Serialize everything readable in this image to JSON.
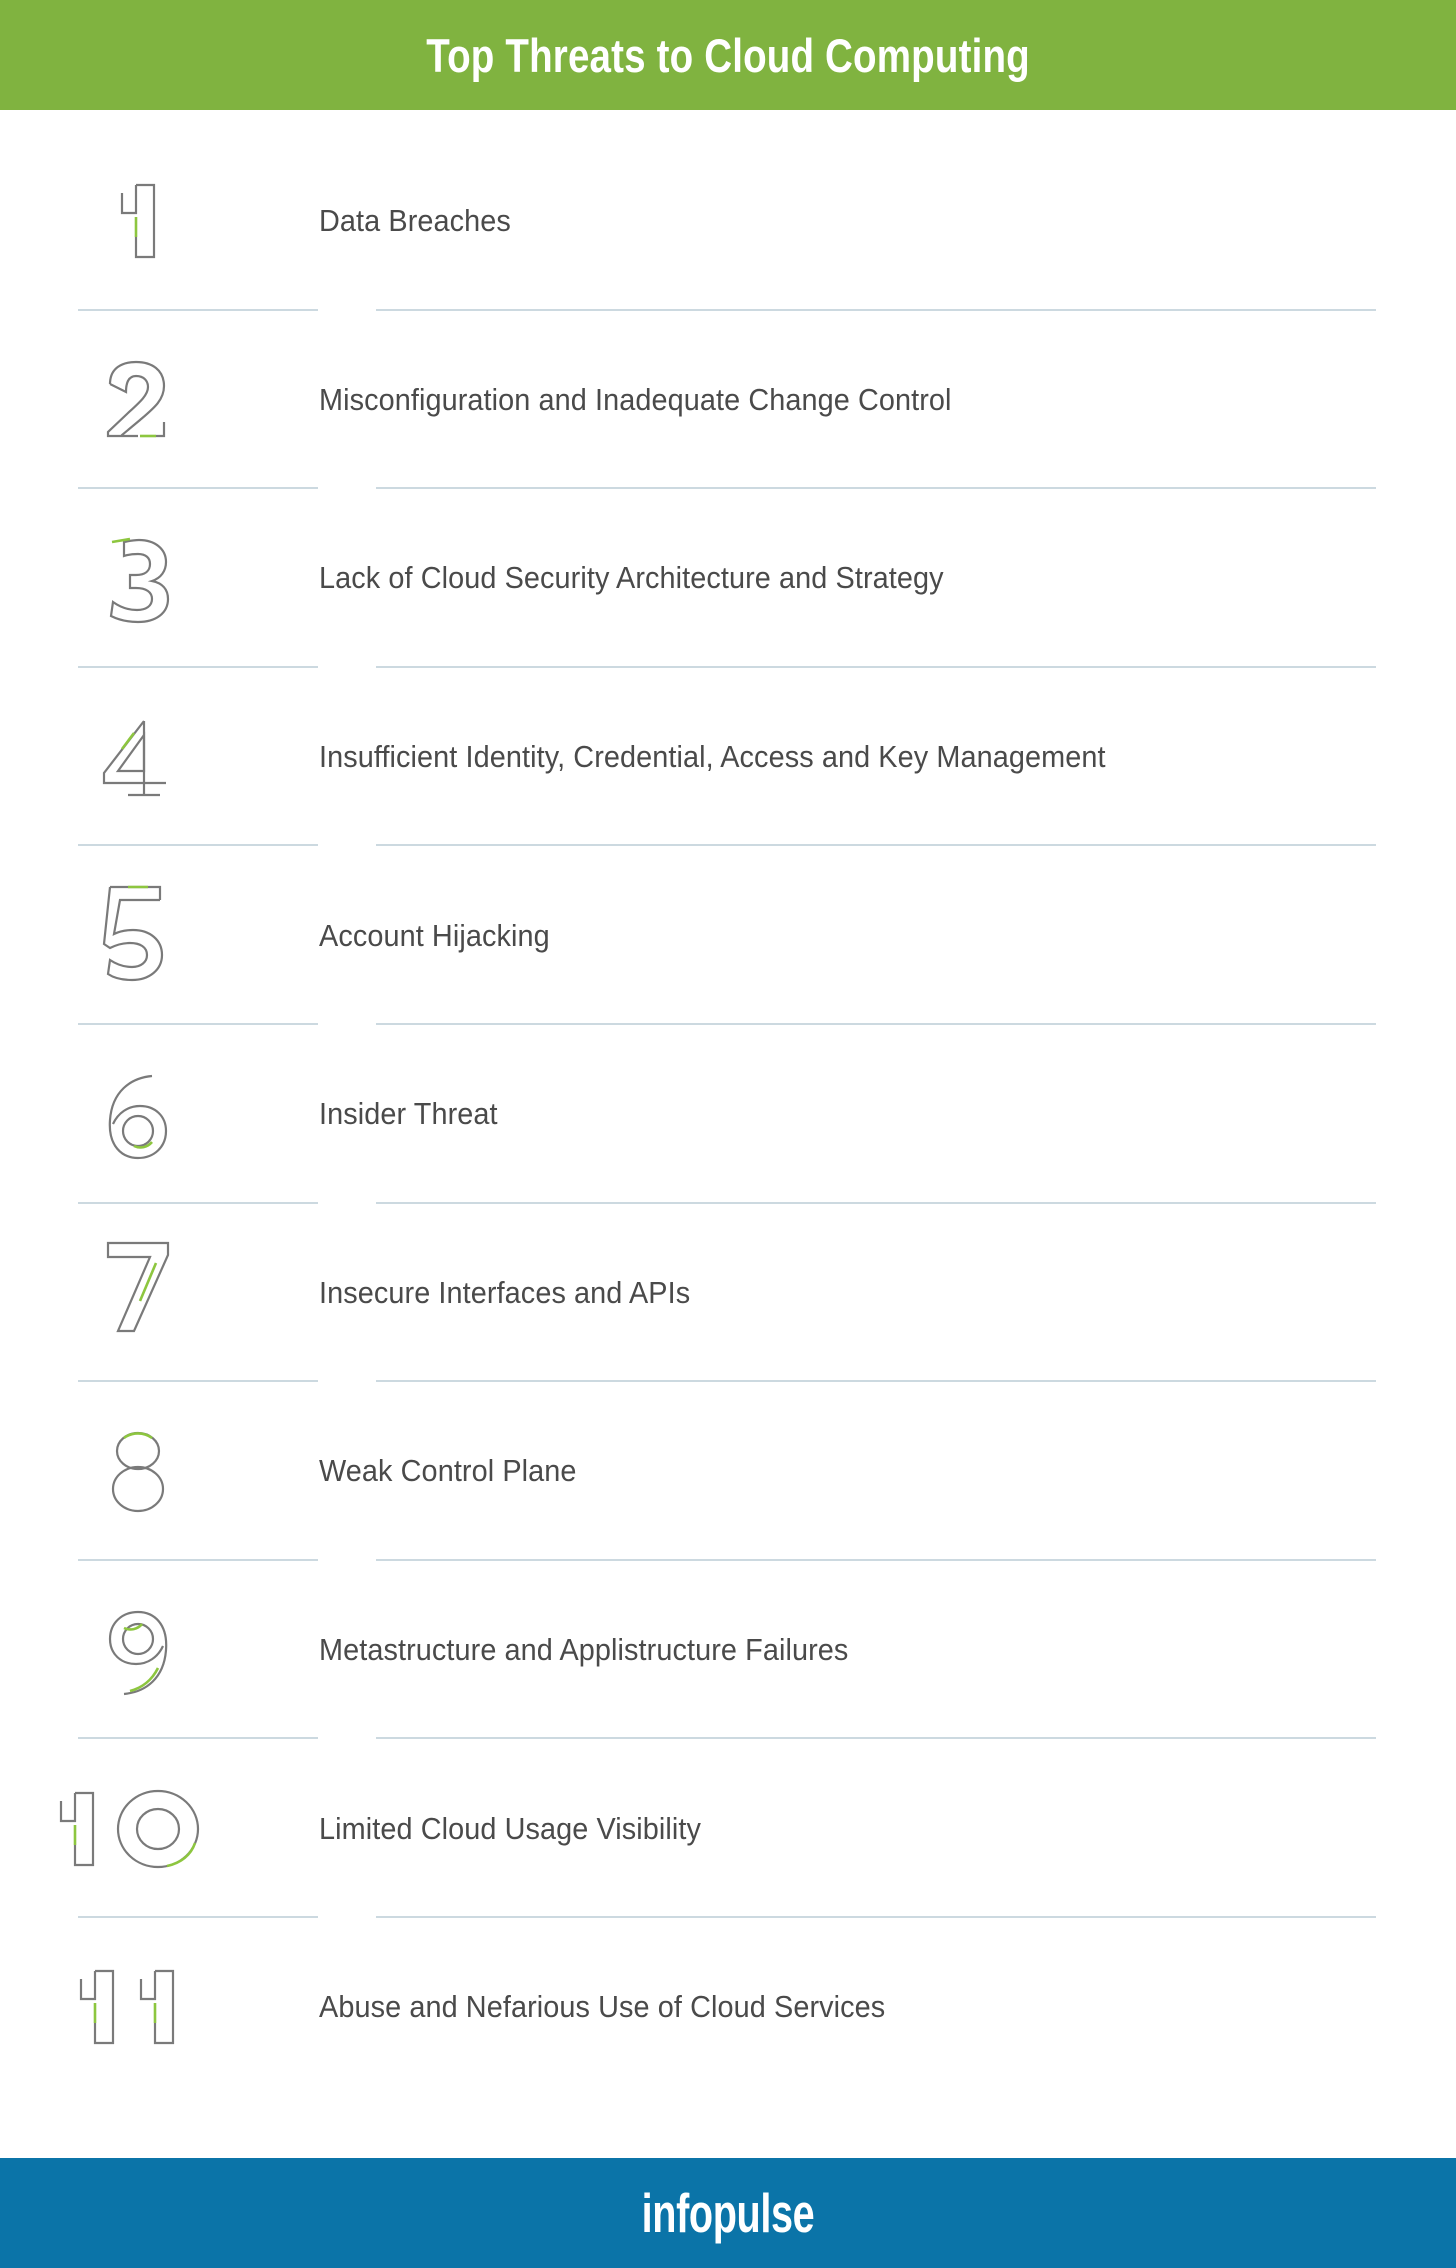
{
  "header": {
    "title": "Top Threats to Cloud Computing",
    "background_color": "#80b340",
    "text_color": "#ffffff"
  },
  "theme": {
    "accent_green": "#8dc63f",
    "number_outline_color": "#7a7a7a",
    "text_color": "#4a4a4a",
    "separator_color": "#ccd9e0",
    "footer_blue": "#0b74a8",
    "page_background": "#ffffff"
  },
  "list": {
    "items": [
      {
        "number": "1",
        "label": "Data Breaches"
      },
      {
        "number": "2",
        "label": "Misconfiguration and Inadequate Change Control"
      },
      {
        "number": "3",
        "label": "Lack of Cloud Security Architecture and Strategy"
      },
      {
        "number": "4",
        "label": "Insufficient Identity, Credential, Access and Key Management"
      },
      {
        "number": "5",
        "label": "Account Hijacking"
      },
      {
        "number": "6",
        "label": "Insider Threat"
      },
      {
        "number": "7",
        "label": "Insecure Interfaces and APIs"
      },
      {
        "number": "8",
        "label": "Weak Control Plane"
      },
      {
        "number": "9",
        "label": "Metastructure and Applistructure Failures"
      },
      {
        "number": "10",
        "label": "Limited Cloud Usage Visibility"
      },
      {
        "number": "11",
        "label": "Abuse and Nefarious Use of Cloud Services"
      }
    ]
  },
  "footer": {
    "logo_text": "infopulse",
    "background_color": "#0b74a8",
    "text_color": "#ffffff"
  }
}
